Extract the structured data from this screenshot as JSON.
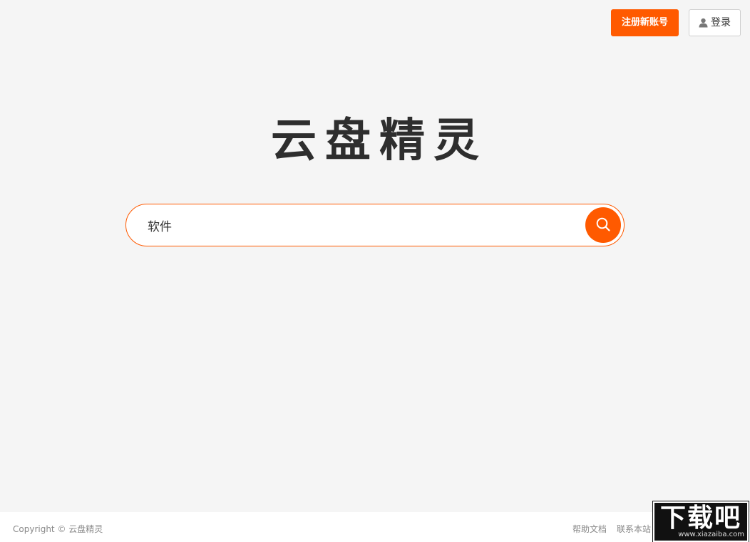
{
  "colors": {
    "accent": "#ff5a00",
    "background": "#f5f5f5",
    "footer_background": "#ffffff",
    "logo_text": "#2e2e2e"
  },
  "header": {
    "register_label": "注册新账号",
    "login_label": "登录",
    "login_icon": "user-icon"
  },
  "logo": {
    "text": "云盘精灵"
  },
  "search": {
    "value": "软件",
    "placeholder": "",
    "button_icon": "search-icon"
  },
  "footer": {
    "copyright": "Copyright © 云盘精灵",
    "links": [
      {
        "label": "帮助文档"
      },
      {
        "label": "联系本站"
      }
    ]
  },
  "watermark": {
    "logo_text": "下载吧",
    "url": "www.xiazaiba.com"
  }
}
